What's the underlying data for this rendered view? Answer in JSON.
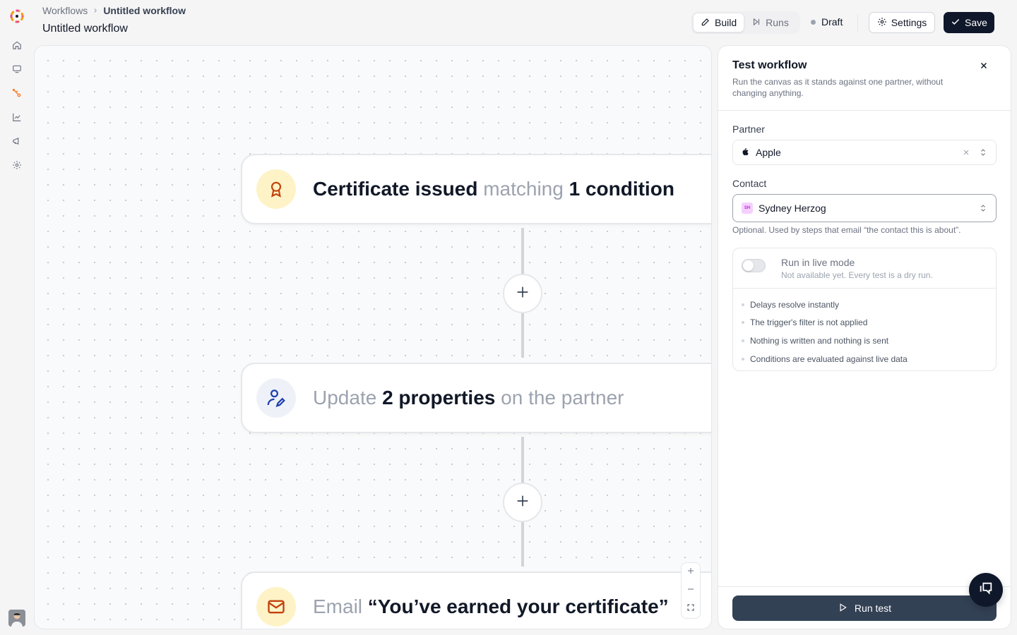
{
  "header": {
    "breadcrumb": [
      "Workflows",
      "Untitled workflow"
    ],
    "title": "Untitled workflow",
    "mode_build": "Build",
    "mode_runs": "Runs",
    "status": "Draft",
    "settings_label": "Settings",
    "save_label": "Save"
  },
  "canvas": {
    "nodes": [
      {
        "parts": [
          "Certificate issued",
          " matching ",
          "1 condition"
        ],
        "icon": "award-icon"
      },
      {
        "parts": [
          "Update ",
          "2 properties",
          " on the partner"
        ],
        "icon": "user-edit-icon"
      },
      {
        "parts": [
          "Email ",
          "“You’ve earned your certificate”"
        ],
        "icon": "mail-icon"
      }
    ]
  },
  "panel": {
    "title": "Test workflow",
    "description": "Run the canvas as it stands against one partner, without changing anything.",
    "partner_label": "Partner",
    "partner_value": "Apple",
    "contact_label": "Contact",
    "contact_initials": "SH",
    "contact_value": "Sydney Herzog",
    "contact_helper": "Optional. Used by steps that email “the contact this is about”.",
    "live_mode_title": "Run in live mode",
    "live_mode_sub": "Not available yet. Every test is a dry run.",
    "dry_run_notes": [
      "Delays resolve instantly",
      "The trigger's filter is not applied",
      "Nothing is written and nothing is sent",
      "Conditions are evaluated against live data"
    ],
    "run_label": "Run test"
  },
  "colors": {
    "primary": "#0f172a",
    "trigger_bg": "#fdf3c7",
    "trigger_icon": "#c2410c",
    "action_bg": "#eef2f8",
    "action_icon": "#1e40af"
  }
}
